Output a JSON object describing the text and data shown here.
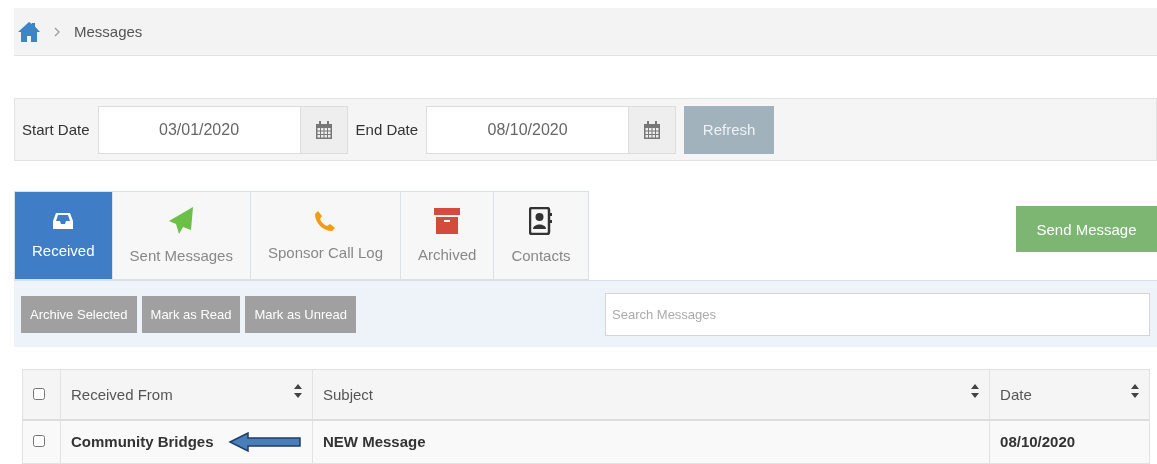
{
  "breadcrumb": {
    "items": [
      "Messages"
    ]
  },
  "date_filter": {
    "start_label": "Start Date",
    "start_value": "03/01/2020",
    "end_label": "End Date",
    "end_value": "08/10/2020",
    "refresh": "Refresh"
  },
  "tabs": [
    {
      "label": "Received",
      "kind": "inbox",
      "selected": true
    },
    {
      "label": "Sent Messages",
      "kind": "sent",
      "selected": false
    },
    {
      "label": "Sponsor Call Log",
      "kind": "phone",
      "selected": false
    },
    {
      "label": "Archived",
      "kind": "archive",
      "selected": false
    },
    {
      "label": "Contacts",
      "kind": "contacts",
      "selected": false
    }
  ],
  "send_button": "Send Message",
  "actions": [
    "Archive Selected",
    "Mark as Read",
    "Mark as Unread"
  ],
  "search": {
    "placeholder": "Search Messages"
  },
  "table": {
    "select_all_checked": false,
    "columns": [
      "Received From",
      "Subject",
      "Date"
    ],
    "rows": [
      {
        "checked": false,
        "from": "Community Bridges",
        "subject": "NEW Message",
        "date": "08/10/2020",
        "annotated": true
      }
    ]
  }
}
